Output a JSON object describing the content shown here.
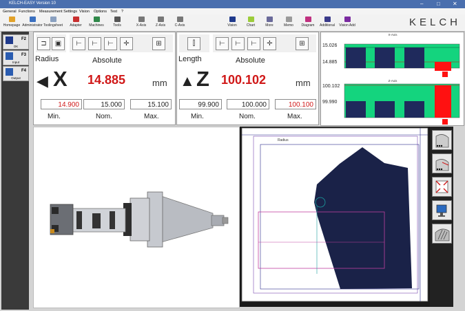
{
  "window": {
    "title": "KELCH-EASY Version 10",
    "controls": [
      "–",
      "□",
      "✕"
    ]
  },
  "menu": [
    "General",
    "Functions",
    "Measurement Settings",
    "Vision",
    "Options",
    "Test",
    "?"
  ],
  "toolbar": {
    "items": [
      "Homepage",
      "Administrator",
      "Toolingsheet",
      "Adapter",
      "Machines",
      "Tools",
      "X-Axis",
      "Z-Axis",
      "C-Axis",
      "Vision",
      "Chart",
      "More",
      "Memo",
      "Diagram",
      "Additional",
      "Vision Add"
    ],
    "brand": "KELCH"
  },
  "nav": [
    {
      "key": "F2",
      "label": "OK"
    },
    {
      "key": "F3",
      "label": "Input"
    },
    {
      "key": "F4",
      "label": "Output"
    }
  ],
  "x_panel": {
    "mode": "Radius",
    "mode2": "Absolute",
    "axis": "X",
    "value": "14.885",
    "unit": "mm",
    "min": "14.900",
    "nom": "15.000",
    "max": "15.100",
    "min_label": "Min.",
    "nom_label": "Nom.",
    "max_label": "Max."
  },
  "z_panel": {
    "mode": "Length",
    "mode2": "Absolute",
    "axis": "Z",
    "value": "100.102",
    "unit": "mm",
    "min": "99.900",
    "nom": "100.000",
    "max": "100.100",
    "min_label": "Min.",
    "nom_label": "Nom.",
    "max_label": "Max."
  },
  "diagram": {
    "x_title": "X-Axis",
    "z_title": "Z-Axis",
    "x_upper": "15.026",
    "x_lower": "14.885",
    "z_upper": "100.102",
    "z_lower": "99.990",
    "colors": {
      "band": "#14d47e",
      "bar": "#1f2a5c",
      "alert": "#ff1111"
    }
  },
  "profile": {
    "label": "Radius"
  }
}
